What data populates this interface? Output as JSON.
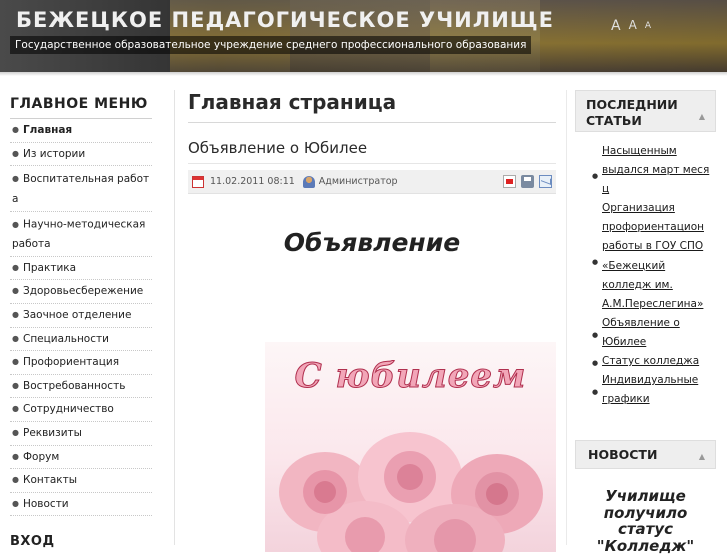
{
  "header": {
    "title": "БЕЖЕЦКОЕ ПЕДАГОГИЧЕСКОЕ УЧИЛИЩЕ",
    "subtitle": "Государственное образовательное учреждение среднего профессионального образования",
    "font_sizes": [
      "A",
      "A",
      "A"
    ]
  },
  "left_menu": {
    "title": "ГЛАВНОЕ МЕНЮ",
    "items": [
      {
        "label": "Главная",
        "active": true
      },
      {
        "label": "Из истории"
      },
      {
        "label": "Воспитательная работ",
        "label2": "а"
      },
      {
        "label": "Научно-методическая",
        "label2": "работа"
      },
      {
        "label": "Практика"
      },
      {
        "label": "Здоровьесбережение"
      },
      {
        "label": "Заочное отделение"
      },
      {
        "label": "Специальности"
      },
      {
        "label": "Профориентация"
      },
      {
        "label": "Востребованность"
      },
      {
        "label": "Сотрудничество"
      },
      {
        "label": "Реквизиты"
      },
      {
        "label": "Форум"
      },
      {
        "label": "Контакты"
      },
      {
        "label": "Новости"
      }
    ],
    "login_title": "ВХОД"
  },
  "main": {
    "page_title": "Главная страница",
    "article_title": "Объявление о Юбилее",
    "date": "11.02.2011 08:11",
    "author": "Администратор",
    "announcement": "Объявление",
    "card_title": "С юбилеем"
  },
  "right": {
    "latest_title_1": "ПОСЛЕДНИИ",
    "latest_title_2": "СТАТЬИ",
    "latest": [
      {
        "lines": [
          "Насыщенным",
          "выдался март меся",
          "ц"
        ]
      },
      {
        "lines": [
          "Организация",
          "профориентацион",
          "работы в ГОУ СПО",
          "«Бежецкий",
          "колледж им.",
          "А.М.Переслегина»"
        ]
      },
      {
        "lines": [
          "Объявление о",
          "Юбилее"
        ]
      },
      {
        "lines": [
          "Статус колледжа"
        ]
      },
      {
        "lines": [
          "Индивидуальные",
          "графики"
        ]
      }
    ],
    "news_title": "НОВОСТИ",
    "news_lines": [
      "Училище",
      "получило",
      "статус",
      "\"Колледж\""
    ]
  },
  "colors": {
    "header_bg": "#3a3a3a",
    "accent_rose": "#b0304f",
    "box_bg": "#eeeeee"
  }
}
